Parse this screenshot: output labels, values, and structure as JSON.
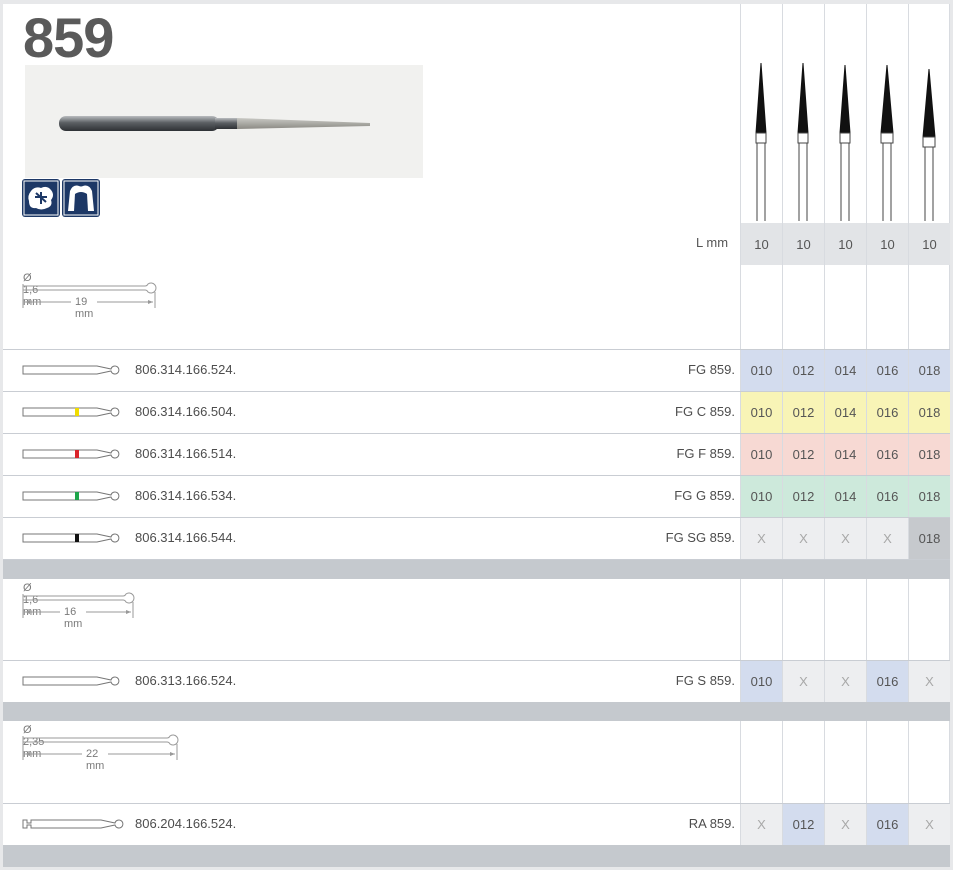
{
  "product": {
    "title": "859",
    "l_label": "L mm",
    "lengths": [
      "10",
      "10",
      "10",
      "10",
      "10"
    ]
  },
  "colors": {
    "blue": "#d3dcee",
    "yellow": "#f8f4b6",
    "red": "#f7d9d3",
    "green": "#cde9db",
    "gray": "#edeef0",
    "dark_gray": "#c6c9cd",
    "len_gray": "#e2e4e7"
  },
  "sections": [
    {
      "diameter": "Ø 1,6 mm",
      "length": "19 mm",
      "rows": [
        {
          "code": "806.314.166.524.",
          "ref": "FG 859.",
          "ring": "none",
          "cells": [
            "010",
            "012",
            "014",
            "016",
            "018"
          ],
          "tones": [
            "blue",
            "blue",
            "blue",
            "blue",
            "blue"
          ]
        },
        {
          "code": "806.314.166.504.",
          "ref": "FG C 859.",
          "ring": "yellow",
          "cells": [
            "010",
            "012",
            "014",
            "016",
            "018"
          ],
          "tones": [
            "yellow",
            "yellow",
            "yellow",
            "yellow",
            "yellow"
          ]
        },
        {
          "code": "806.314.166.514.",
          "ref": "FG F 859.",
          "ring": "red",
          "cells": [
            "010",
            "012",
            "014",
            "016",
            "018"
          ],
          "tones": [
            "red",
            "red",
            "red",
            "red",
            "red"
          ]
        },
        {
          "code": "806.314.166.534.",
          "ref": "FG G 859.",
          "ring": "green",
          "cells": [
            "010",
            "012",
            "014",
            "016",
            "018"
          ],
          "tones": [
            "green",
            "green",
            "green",
            "green",
            "green"
          ]
        },
        {
          "code": "806.314.166.544.",
          "ref": "FG SG 859.",
          "ring": "black",
          "cells": [
            "X",
            "X",
            "X",
            "X",
            "018"
          ],
          "tones": [
            "gray",
            "gray",
            "gray",
            "gray",
            "dark_gray"
          ]
        }
      ]
    },
    {
      "diameter": "Ø 1,6 mm",
      "length": "16 mm",
      "rows": [
        {
          "code": "806.313.166.524.",
          "ref": "FG S 859.",
          "ring": "none",
          "cells": [
            "010",
            "X",
            "X",
            "016",
            "X"
          ],
          "tones": [
            "blue",
            "gray",
            "gray",
            "blue",
            "gray"
          ]
        }
      ]
    },
    {
      "diameter": "Ø 2,35 mm",
      "length": "22 mm",
      "rows": [
        {
          "code": "806.204.166.524.",
          "ref": "RA 859.",
          "ring": "none",
          "cells": [
            "X",
            "012",
            "X",
            "016",
            "X"
          ],
          "tones": [
            "gray",
            "blue",
            "gray",
            "blue",
            "gray"
          ]
        }
      ]
    }
  ]
}
